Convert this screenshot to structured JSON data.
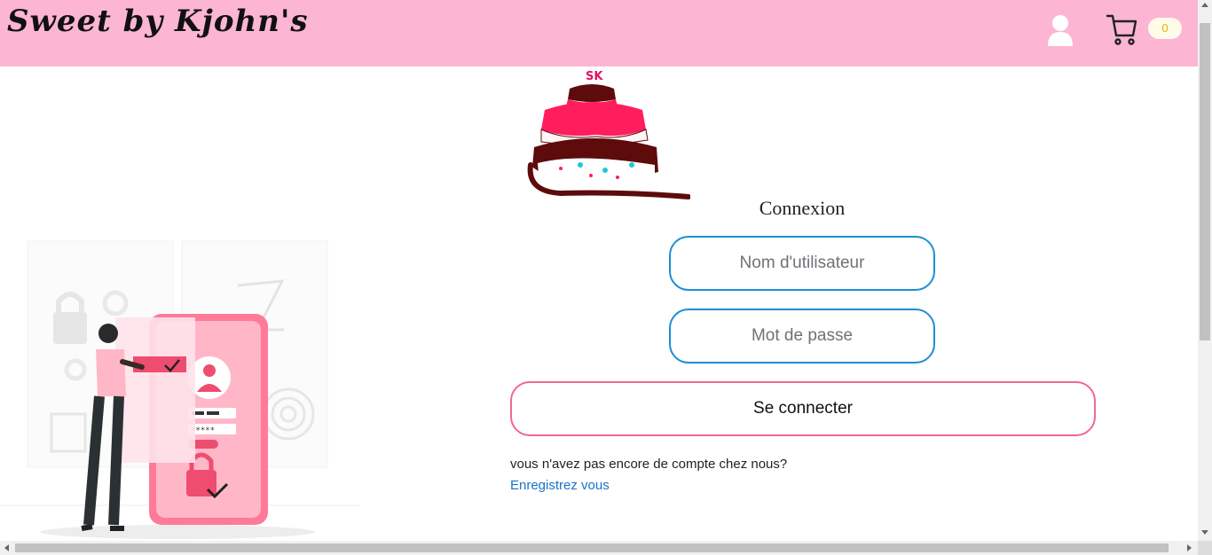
{
  "header": {
    "brand": "Sweet by Kjohn's",
    "cart_count": "0",
    "icons": {
      "user": "user-icon",
      "cart": "cart-icon"
    },
    "colors": {
      "header_bg": "#fdb5d4",
      "cart_badge_text": "#e8b100"
    }
  },
  "logo": {
    "initials": "SK"
  },
  "login": {
    "title": "Connexion",
    "username_placeholder": "Nom d'utilisateur",
    "password_placeholder": "Mot de passe",
    "submit_label": "Se connecter",
    "no_account_text": "vous n'avez pas encore de compte chez nous?",
    "register_link": "Enregistrez vous",
    "colors": {
      "input_border": "#1d8fd1",
      "button_border": "#ef6a8c",
      "link": "#1a73c8"
    }
  }
}
